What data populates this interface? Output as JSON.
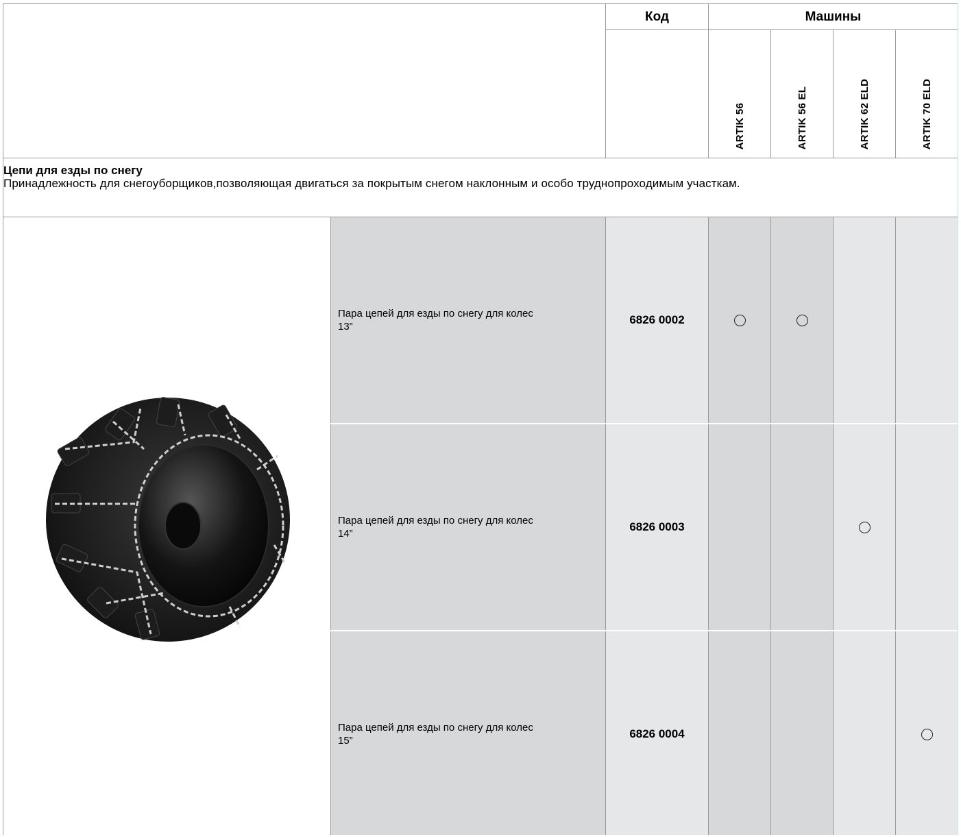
{
  "header": {
    "code_label": "Код",
    "machines_label": "Машины",
    "machines": [
      "ARTIK 56",
      "ARTIK 56 EL",
      "ARTIK 62 ELD",
      "ARTIK 70 ELD"
    ]
  },
  "section": {
    "title": "Цепи для езды по снегу",
    "description": "Принадлежность для снегоуборщиков,позволяющая двигаться за покрытым снегом наклонным и особо труднопроходимым участкам."
  },
  "rows": [
    {
      "desc_line1": "Пара цепей для езды по снегу для колес",
      "desc_line2": "13”",
      "code": "6826 0002",
      "fits": [
        true,
        true,
        false,
        false
      ]
    },
    {
      "desc_line1": "Пара цепей для езды по снегу для колес",
      "desc_line2": "14”",
      "code": "6826 0003",
      "fits": [
        false,
        false,
        true,
        false
      ]
    },
    {
      "desc_line1": "Пара цепей для езды по снегу для колес",
      "desc_line2": "15”",
      "code": "6826 0004",
      "fits": [
        false,
        false,
        false,
        true
      ]
    }
  ],
  "image": {
    "icon": "snow-chain-wheel-image"
  },
  "colors": {
    "cell_dark": "#d7d8d9",
    "cell_light": "#e6e7e8",
    "grid": "#9a9a9a"
  }
}
